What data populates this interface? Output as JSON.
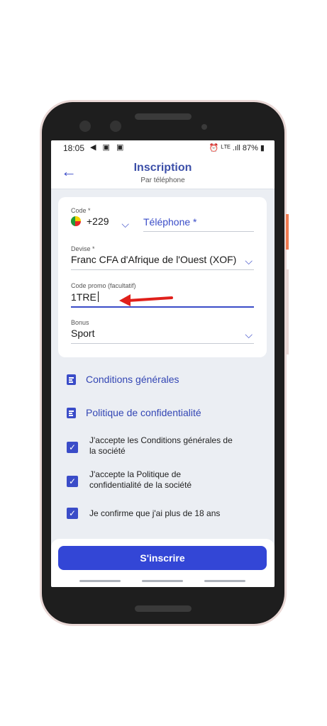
{
  "status_bar": {
    "time": "18:05",
    "left_icons": "◀ ▣ ▣",
    "right_icons": "⏰ ᴸᵀᴱ .ıll 87% ▮"
  },
  "header": {
    "title": "Inscription",
    "subtitle": "Par téléphone"
  },
  "form": {
    "code_label": "Code *",
    "code_value": "+229",
    "phone_placeholder": "Téléphone *",
    "currency_label": "Devise *",
    "currency_value": "Franc CFA d'Afrique de l'Ouest (XOF)",
    "promo_label": "Code promo (facultatif)",
    "promo_value": "1TRE",
    "bonus_label": "Bonus",
    "bonus_value": "Sport"
  },
  "links": {
    "terms": "Conditions générales",
    "privacy": "Politique de confidentialité"
  },
  "checks": [
    {
      "line1": "J'accepte les Conditions générales de",
      "line2": "la société"
    },
    {
      "line1": "J'accepte la Politique de",
      "line2": "confidentialité de la société"
    },
    {
      "line1": "Je confirme que j'ai plus de 18 ans",
      "line2": ""
    }
  ],
  "submit_label": "S'inscrire",
  "colors": {
    "accent": "#3346d6",
    "title": "#3b4fa8",
    "annotation_arrow": "#e0201b"
  }
}
